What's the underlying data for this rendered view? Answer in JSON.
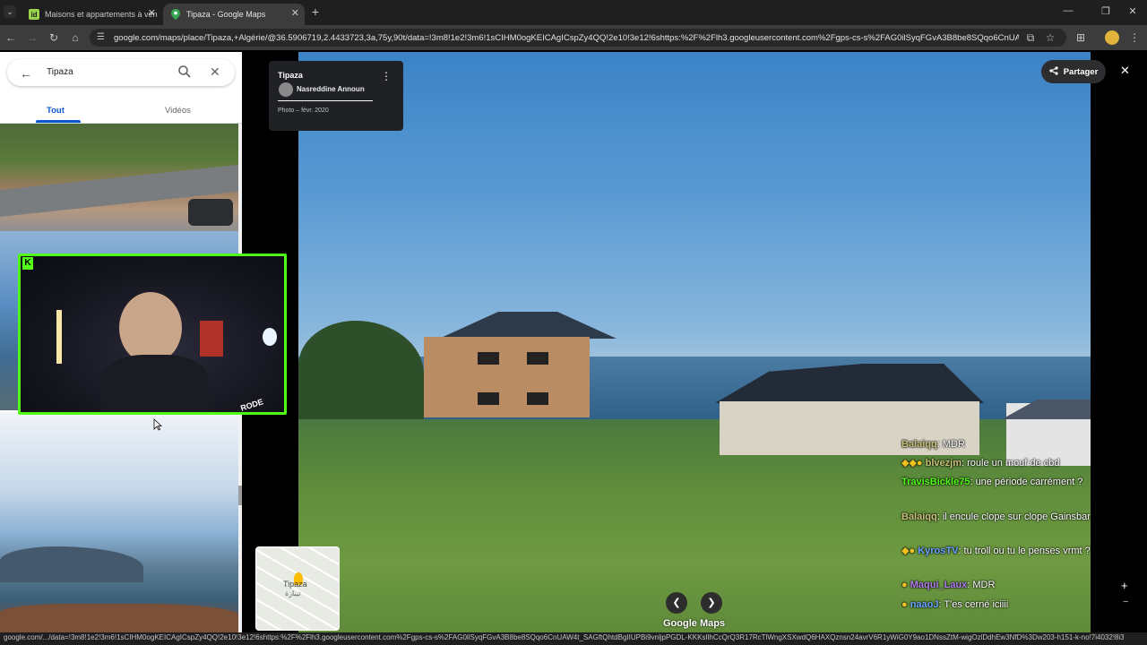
{
  "browser": {
    "tabs": [
      {
        "label": "Maisons et appartements à ven",
        "favicon": "id"
      },
      {
        "label": "Tipaza - Google Maps"
      }
    ],
    "url": "google.com/maps/place/Tipaza,+Algérie/@36.5906719,2.4433723,3a,75y,90t/data=!3m8!1e2!3m6!1sCIHM0ogKEICAgICspZy4QQ!2e10!3e12!6shttps:%2F%2Flh3.googleusercontent.com%2Fgps-cs-s%2FAG0ilSyqFGvA3B8be8SQqo6CnUAW4t_SA...",
    "status_url": "google.com/.../data=!3m8!1e2!3m6!1sCIHM0ogKEICAgICspZy4QQ!2e10!3e12!6shttps:%2F%2Flh3.googleusercontent.com%2Fgps-cs-s%2FAG0ilSyqFGvA3B8be8SQqo6CnUAW4t_SAGftQhtdBgIIUPBi9vnljpPGDL-KKKsIlhCcQrQ3R17RcTlWngXSXwdQ6HAXQznsn24avrV6R1yWiG0Y9ao1DNssZtM-wigOzlDdhEw3NfD%3Dw203-h151-k-no!7i4032!8i3016!4m7!..."
  },
  "search": {
    "query": "Tipaza"
  },
  "left_tabs": {
    "all": "Tout",
    "videos": "Vidéos"
  },
  "photo_card": {
    "title": "Tipaza",
    "author": "Nasreddine Announ",
    "date": "Photo – févr. 2020"
  },
  "viewer": {
    "share_label": "Partager",
    "logo": "Google Maps"
  },
  "minimap": {
    "label": "Tipaza",
    "label_arabic": "تيبازة"
  },
  "overlay": {
    "mic_brand": "RODE"
  },
  "chat": [
    {
      "user": "Balaiqq",
      "text": ": MDR",
      "color": "#c9c07a"
    },
    {
      "user": "blvezjm",
      "text": ": roule un mouf de cbd",
      "color": "#c9c07a"
    },
    {
      "user": "TravisBickle75",
      "text": ": une période carrément ?",
      "color": "#53fc18"
    },
    {
      "user": "Balaiqq",
      "text": ": il encule clope sur clope Gainsbar",
      "color": "#c9c07a"
    },
    {
      "user": "KyrosTV",
      "text": ": tu troll ou tu le penses vrmt ?",
      "color": "#6aa5ff"
    },
    {
      "user": "Maqui_Laux",
      "text": ": MDR",
      "color": "#b07cf0"
    },
    {
      "user": "naaoJ",
      "text": ": T'es cerné iciiii",
      "color": "#6aa5ff"
    }
  ]
}
